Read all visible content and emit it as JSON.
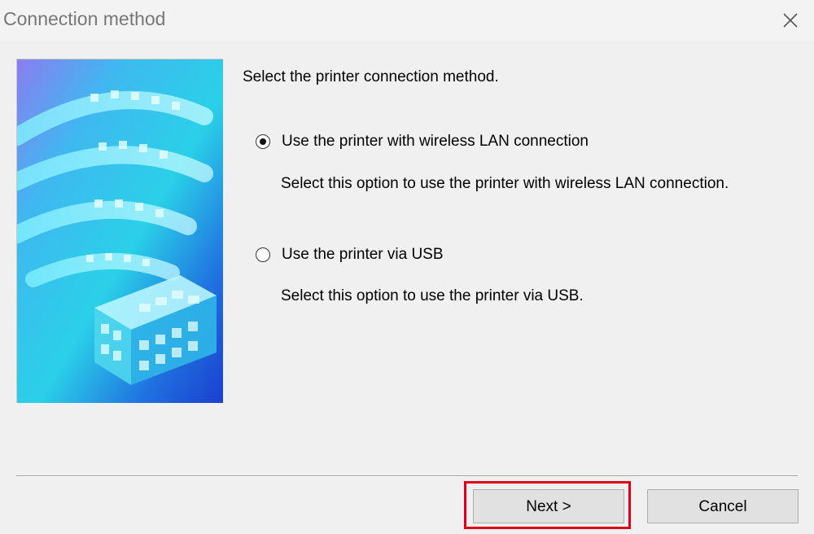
{
  "window": {
    "title": "Connection method"
  },
  "main": {
    "prompt": "Select the printer connection method.",
    "options": [
      {
        "label": "Use the printer with wireless LAN connection",
        "description": "Select this option to use the printer with wireless LAN connection.",
        "selected": true
      },
      {
        "label": "Use the printer via USB",
        "description": "Select this option to use the printer via USB.",
        "selected": false
      }
    ]
  },
  "footer": {
    "next_label": "Next >",
    "cancel_label": "Cancel"
  },
  "icons": {
    "close": "close-icon",
    "illustration": "wireless-printer-illustration"
  },
  "colors": {
    "highlight": "#e0001a",
    "art_light": "#3fe0f0",
    "art_dark": "#1a3fd0"
  }
}
